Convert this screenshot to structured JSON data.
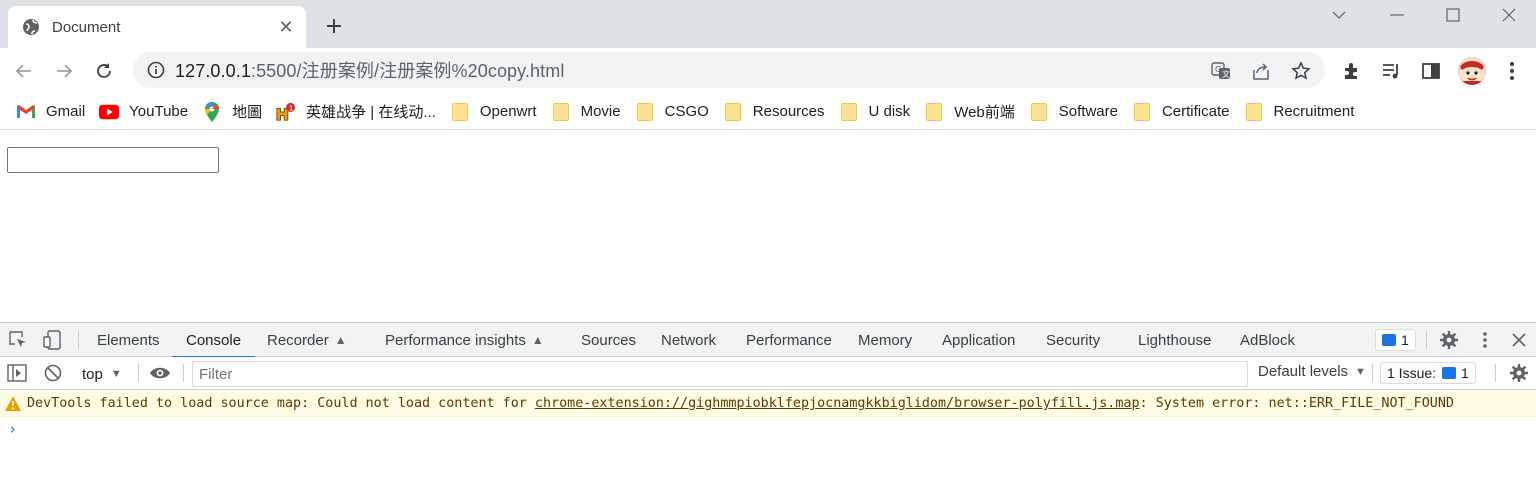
{
  "tab": {
    "title": "Document",
    "close": "✕",
    "new_tab": "+"
  },
  "toolbar": {
    "url_host": "127.0.0.1",
    "url_path": ":5500/注册案例/注册案例%20copy.html"
  },
  "bookmarks": [
    {
      "label": "Gmail",
      "icon": "gmail-icon"
    },
    {
      "label": "YouTube",
      "icon": "youtube-icon"
    },
    {
      "label": "地圖",
      "icon": "maps-icon"
    },
    {
      "label": "英雄战争 | 在线动...",
      "icon": "game-icon"
    },
    {
      "label": "Openwrt",
      "icon": "folder-icon"
    },
    {
      "label": "Movie",
      "icon": "folder-icon"
    },
    {
      "label": "CSGO",
      "icon": "folder-icon"
    },
    {
      "label": "Resources",
      "icon": "folder-icon"
    },
    {
      "label": "U disk",
      "icon": "folder-icon"
    },
    {
      "label": "Web前端",
      "icon": "folder-icon"
    },
    {
      "label": "Software",
      "icon": "folder-icon"
    },
    {
      "label": "Certificate",
      "icon": "folder-icon"
    },
    {
      "label": "Recruitment",
      "icon": "folder-icon"
    }
  ],
  "devtools": {
    "tabs": {
      "elements": "Elements",
      "console": "Console",
      "recorder": "Recorder",
      "performance_insights": "Performance insights",
      "sources": "Sources",
      "network": "Network",
      "performance": "Performance",
      "memory": "Memory",
      "application": "Application",
      "security": "Security",
      "lighthouse": "Lighthouse",
      "adblock": "AdBlock"
    },
    "issues_count": "1",
    "console": {
      "context": "top",
      "filter_placeholder": "Filter",
      "levels": "Default levels",
      "issue_label": "1 Issue:",
      "issue_count": "1",
      "warning_prefix": "DevTools failed to load source map: Could not load content for ",
      "warning_link": "chrome-extension://gighmmpiobklfepjocnamgkkbiglidom/browser-polyfill.js.map",
      "warning_suffix": ": System error: net::ERR_FILE_NOT_FOUND",
      "prompt": "›"
    }
  },
  "colors": {
    "accent": "#1a73e8",
    "warning_bg": "#fffbe5",
    "tabstrip": "#dee1e6"
  }
}
